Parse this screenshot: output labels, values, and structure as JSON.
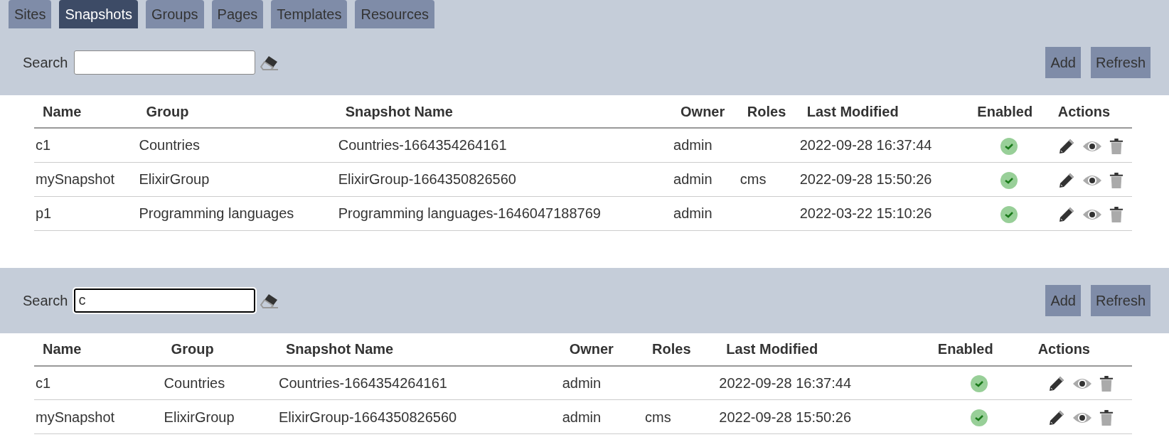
{
  "tabs": [
    {
      "label": "Sites",
      "selected": false
    },
    {
      "label": "Snapshots",
      "selected": true
    },
    {
      "label": "Groups",
      "selected": false
    },
    {
      "label": "Pages",
      "selected": false
    },
    {
      "label": "Templates",
      "selected": false
    },
    {
      "label": "Resources",
      "selected": false
    }
  ],
  "panels": [
    {
      "search": {
        "label": "Search",
        "focused": false
      },
      "buttons": [
        "Add",
        "Refresh"
      ],
      "table": {
        "columns": [
          "Name",
          "Group",
          "Snapshot Name",
          "Owner",
          "Roles",
          "Last Modified",
          "Enabled",
          "Actions"
        ],
        "rows": [
          {
            "cells": [
              "c1",
              "Countries",
              "Countries-1664354264161",
              "admin",
              "",
              "2022-09-28 16:37:44"
            ],
            "enabled": true
          },
          {
            "cells": [
              "mySnapshot",
              "ElixirGroup",
              "ElixirGroup-1664350826560",
              "admin",
              "cms",
              "2022-09-28 15:50:26"
            ],
            "enabled": true
          },
          {
            "cells": [
              "p1",
              "Programming languages",
              "Programming languages-1646047188769",
              "admin",
              "",
              "2022-03-22 15:10:26"
            ],
            "enabled": true
          }
        ]
      }
    },
    {
      "search": {
        "label": "Search",
        "value": "c",
        "focused": true
      },
      "buttons": [
        "Add",
        "Refresh"
      ],
      "table": {
        "columns": [
          "Name",
          "Group",
          "Snapshot Name",
          "Owner",
          "Roles",
          "Last Modified",
          "Enabled",
          "Actions"
        ],
        "rows": [
          {
            "cells": [
              "c1",
              "Countries",
              "Countries-1664354264161",
              "admin",
              "",
              "2022-09-28 16:37:44"
            ],
            "enabled": true
          },
          {
            "cells": [
              "mySnapshot",
              "ElixirGroup",
              "ElixirGroup-1664350826560",
              "admin",
              "cms",
              "2022-09-28 15:50:26"
            ],
            "enabled": true
          }
        ]
      }
    }
  ]
}
